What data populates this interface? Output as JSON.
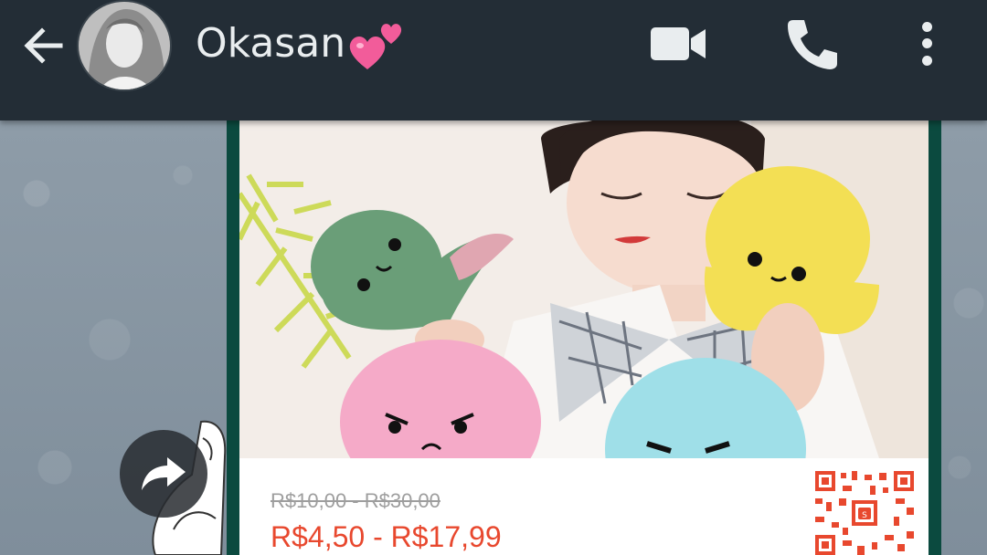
{
  "header": {
    "contact_name": "Okasan",
    "contact_emoji": "two-hearts-icon",
    "back_icon": "arrow-left-icon",
    "video_icon": "video-camera-icon",
    "call_icon": "phone-icon",
    "menu_icon": "more-vertical-icon"
  },
  "message": {
    "old_price": "R$10,00 - R$30,00",
    "new_price": "R$4,50 - R$17,99",
    "image": "product-photo-octopus-plush",
    "qr": "qr-code-icon"
  },
  "colors": {
    "header_bg": "#232d36",
    "bubble_bg": "#0b4a3f",
    "price_red": "#e8482e",
    "old_price_grey": "#9e9e9e"
  }
}
